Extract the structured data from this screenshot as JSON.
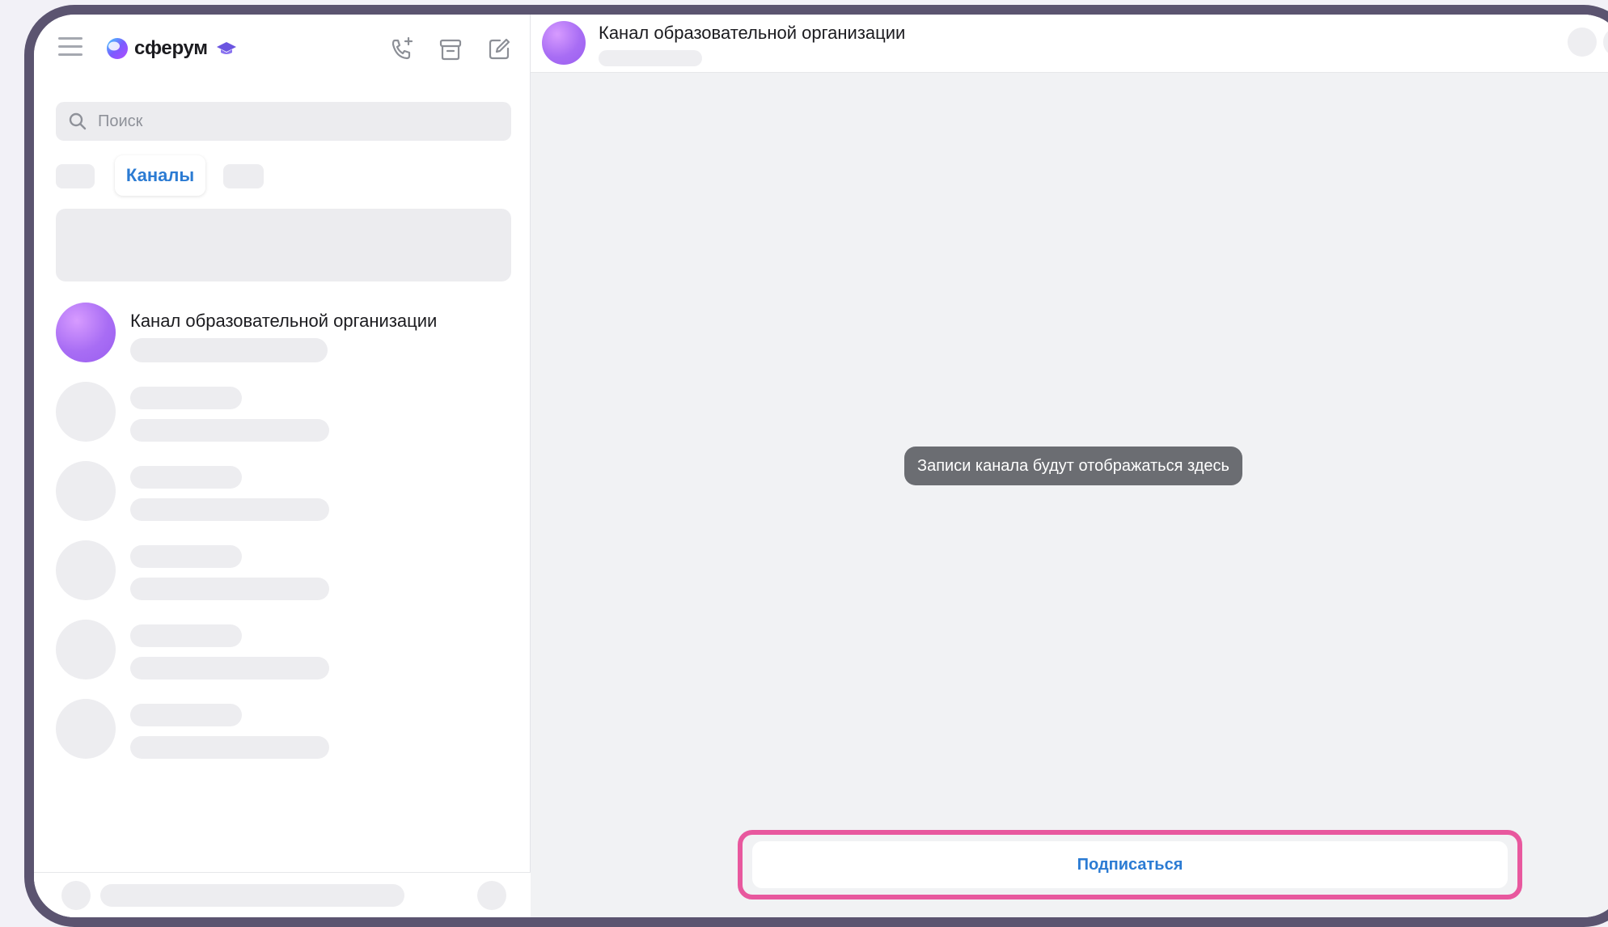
{
  "app": {
    "name": "сферум"
  },
  "sidebar": {
    "search": {
      "placeholder": "Поиск"
    },
    "tabs": [
      {
        "label": "",
        "active": false
      },
      {
        "label": "Каналы",
        "active": true
      },
      {
        "label": "",
        "active": false
      }
    ],
    "chats": [
      {
        "title": "Канал образовательной организации"
      }
    ]
  },
  "main": {
    "header": {
      "title": "Канал образовательной организации"
    },
    "empty_message": "Записи канала будут отображаться здесь",
    "subscribe_label": "Подписаться"
  },
  "colors": {
    "accent": "#2b7bd3",
    "highlight": "#e8589e",
    "avatar": "#a86df4"
  },
  "icons": [
    "menu-icon",
    "add-call-icon",
    "archive-icon",
    "compose-icon",
    "search-icon",
    "graduation-cap-icon"
  ]
}
